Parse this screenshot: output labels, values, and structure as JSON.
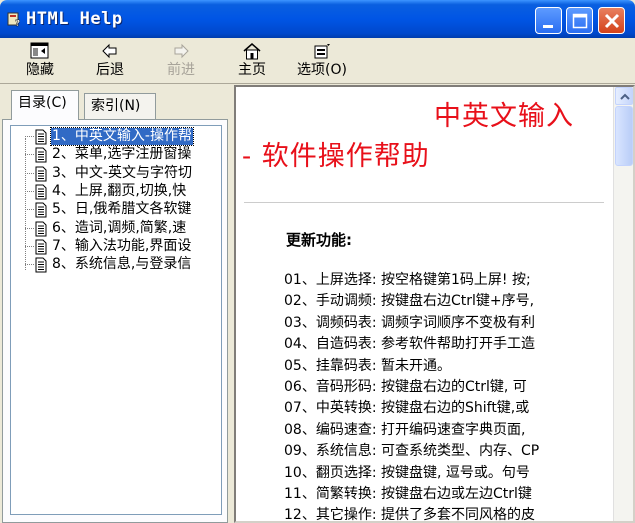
{
  "window": {
    "title": "HTML Help"
  },
  "toolbar": {
    "hide": "隐藏",
    "back": "后退",
    "forward": "前进",
    "home": "主页",
    "options": "选项(O)"
  },
  "tabs": {
    "contents": "目录(C)",
    "index": "索引(N)"
  },
  "tree": [
    "1、中英文输入-操作帮",
    "2、菜单,选字注册窗操",
    "3、中文-英文与字符切",
    "4、上屏,翻页,切换,快",
    "5、日,俄希腊文各软键",
    "6、造词,调频,简繁,速",
    "7、输入法功能,界面设",
    "8、系统信息,与登录信"
  ],
  "doc": {
    "title_line1": "中英文输入",
    "title_line2": "- 软件操作帮助",
    "section": "更新功能:",
    "features": [
      "01、上屏选择: 按空格键第1码上屏! 按;",
      "02、手动调频: 按键盘右边Ctrl键+序号,",
      "03、调频码表: 调频字词顺序不变极有利",
      "04、自造码表: 参考软件帮助打开手工造",
      "05、挂靠码表: 暂未开通。",
      "06、音码形码: 按键盘右边的Ctrl键, 可",
      "07、中英转换: 按键盘右边的Shift键,或",
      "08、编码速查: 打开编码速查字典页面,",
      "09、系统信息: 可查系统类型、内存、CP",
      "10、翻页选择: 按键盘键, 逗号或。句号",
      "11、简繁转换: 按键盘右边或左边Ctrl键",
      "12、其它操作: 提供了多套不同风格的皮"
    ]
  }
}
